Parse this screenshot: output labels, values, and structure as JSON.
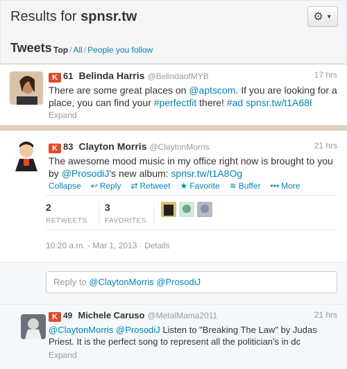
{
  "header": {
    "results_prefix": "Results for ",
    "query": "spnsr.tw",
    "tweets_heading": "Tweets",
    "filters": [
      "Top",
      "All",
      "People you follow"
    ],
    "gear_icon": "gear-icon"
  },
  "tweets": [
    {
      "klout_badge": "K",
      "klout_score": "61",
      "name": "Belinda Harris",
      "handle": "@BelindaofMYB",
      "time": "17 hrs",
      "text_parts": [
        "There are some great places on ",
        "@aptscom",
        ". If you are looking for a place, you can find your ",
        "#perfectfit",
        " there! ",
        "#ad",
        " ",
        "spnsr.tw/t1A68I"
      ],
      "expand": "Expand"
    },
    {
      "klout_badge": "K",
      "klout_score": "83",
      "name": "Clayton Morris",
      "handle": "@ClaytonMorris",
      "time": "21 hrs",
      "text_parts": [
        "The awesome mood music in my office right now is brought to you by ",
        "@ProsodiJ",
        "'s new album: ",
        "spnsr.tw/t1A8Og"
      ],
      "actions": [
        "Collapse",
        "Reply",
        "Retweet",
        "Favorite",
        "Buffer",
        "More"
      ],
      "retweets": "2",
      "retweets_label": "RETWEETS",
      "favorites": "3",
      "favorites_label": "FAVORITES",
      "timestamp": "10:20 a.m. - Mar 1, 2013",
      "details": "Details",
      "reply_prefix": "Reply to ",
      "reply_mentions": "@ClaytonMorris @ProsodiJ"
    },
    {
      "klout_badge": "K",
      "klout_score": "49",
      "name": "Michele Caruso",
      "handle": "@MetalMama2011",
      "time": "21 hrs",
      "text_parts": [
        "@ClaytonMorris",
        " ",
        "@ProsodiJ",
        " Listen to \"Breaking The Law\" by Judas Priest. It is the perfect song to represent all the politician's in dc"
      ],
      "expand": "Expand"
    }
  ],
  "colors": {
    "link": "#0084b4",
    "klout": "#e24a2b",
    "muted": "#999999"
  }
}
